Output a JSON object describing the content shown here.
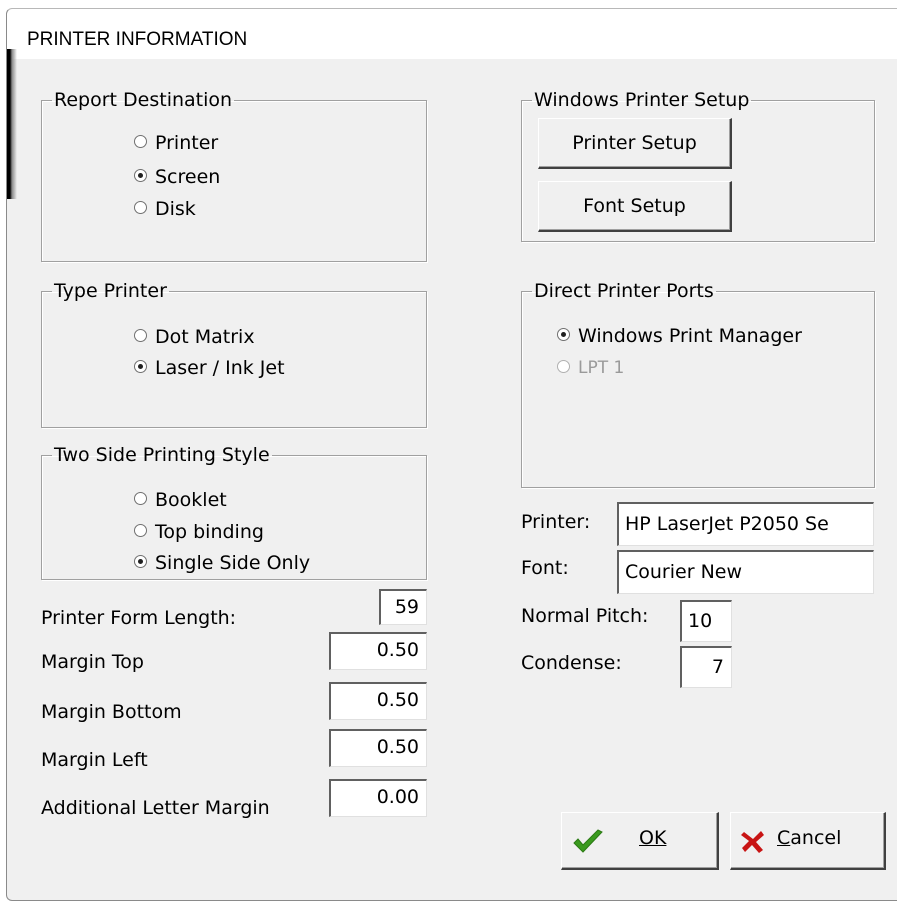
{
  "window": {
    "title": "PRINTER INFORMATION"
  },
  "report_destination": {
    "legend": "Report Destination",
    "options": [
      {
        "label": "Printer",
        "checked": false
      },
      {
        "label": "Screen",
        "checked": true
      },
      {
        "label": "Disk",
        "checked": false
      }
    ]
  },
  "type_printer": {
    "legend": "Type Printer",
    "options": [
      {
        "label": "Dot Matrix",
        "checked": false
      },
      {
        "label": "Laser / Ink Jet",
        "checked": true
      }
    ]
  },
  "two_side": {
    "legend": "Two Side Printing Style",
    "options": [
      {
        "label": "Booklet",
        "checked": false
      },
      {
        "label": "Top binding",
        "checked": false
      },
      {
        "label": "Single Side Only",
        "checked": true
      }
    ]
  },
  "windows_setup": {
    "legend": "Windows Printer Setup",
    "printer_setup_label": "Printer Setup",
    "font_setup_label": "Font Setup"
  },
  "direct_ports": {
    "legend": "Direct Printer Ports",
    "options": [
      {
        "label": "Windows Print Manager",
        "checked": true,
        "enabled": true
      },
      {
        "label": "LPT 1",
        "checked": false,
        "enabled": false
      }
    ]
  },
  "margins": {
    "form_length_label": "Printer Form Length:",
    "form_length_value": "59",
    "top_label": "Margin Top",
    "top_value": "0.50",
    "bottom_label": "Margin Bottom",
    "bottom_value": "0.50",
    "left_label": "Margin Left",
    "left_value": "0.50",
    "additional_label": "Additional Letter Margin",
    "additional_value": "0.00"
  },
  "printer_info": {
    "printer_label": "Printer:",
    "printer_value": "HP LaserJet P2050 Se",
    "font_label": "Font:",
    "font_value": "Courier New",
    "pitch_label": "Normal Pitch:",
    "pitch_value": "10",
    "condense_label": "Condense:",
    "condense_value": "7"
  },
  "buttons": {
    "ok_label": "OK",
    "cancel_label": "Cancel"
  },
  "icons": {
    "ok": "green-checkmark-icon",
    "cancel": "red-x-icon"
  },
  "colors": {
    "ok_check": "#3a9a1e",
    "cancel_x": "#c81414"
  }
}
